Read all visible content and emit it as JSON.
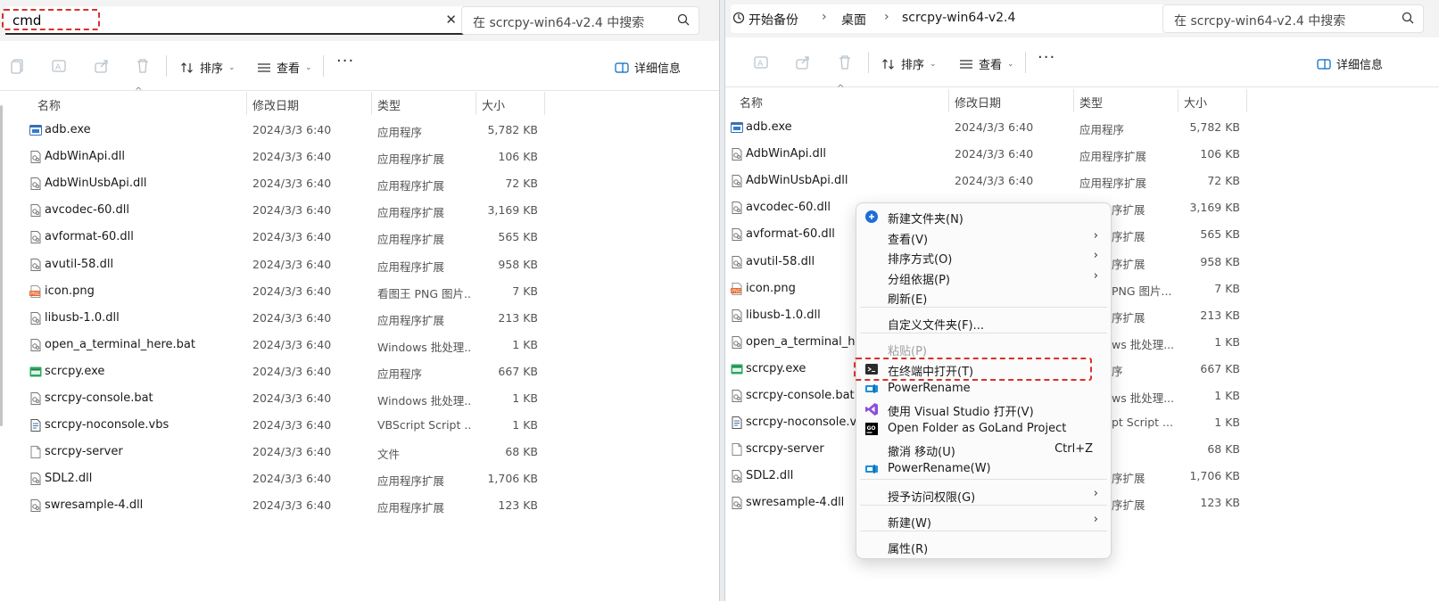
{
  "left": {
    "search_value": "cmd",
    "search_placeholder": "在 scrcpy-win64-v2.4 中搜索",
    "sort_label": "排序",
    "view_label": "查看",
    "details_label": "详细信息"
  },
  "right": {
    "breadcrumbs": [
      "开始备份",
      "桌面",
      "scrcpy-win64-v2.4"
    ],
    "search_placeholder": "在 scrcpy-win64-v2.4 中搜索",
    "sort_label": "排序",
    "view_label": "查看",
    "details_label": "详细信息"
  },
  "columns": {
    "name": "名称",
    "date": "修改日期",
    "type": "类型",
    "size": "大小"
  },
  "files": [
    {
      "name": "adb.exe",
      "date": "2024/3/3 6:40",
      "type": "应用程序",
      "size": "5,782 KB",
      "icon": "exe-icon"
    },
    {
      "name": "AdbWinApi.dll",
      "date": "2024/3/3 6:40",
      "type": "应用程序扩展",
      "size": "106 KB",
      "icon": "dll-icon"
    },
    {
      "name": "AdbWinUsbApi.dll",
      "date": "2024/3/3 6:40",
      "type": "应用程序扩展",
      "size": "72 KB",
      "icon": "dll-icon"
    },
    {
      "name": "avcodec-60.dll",
      "date": "2024/3/3 6:40",
      "type": "应用程序扩展",
      "size": "3,169 KB",
      "icon": "dll-icon"
    },
    {
      "name": "avformat-60.dll",
      "date": "2024/3/3 6:40",
      "type": "应用程序扩展",
      "size": "565 KB",
      "icon": "dll-icon"
    },
    {
      "name": "avutil-58.dll",
      "date": "2024/3/3 6:40",
      "type": "应用程序扩展",
      "size": "958 KB",
      "icon": "dll-icon"
    },
    {
      "name": "icon.png",
      "date": "2024/3/3 6:40",
      "type": "看图王 PNG 图片...",
      "size": "7 KB",
      "icon": "png-icon"
    },
    {
      "name": "libusb-1.0.dll",
      "date": "2024/3/3 6:40",
      "type": "应用程序扩展",
      "size": "213 KB",
      "icon": "dll-icon"
    },
    {
      "name": "open_a_terminal_here.bat",
      "date": "2024/3/3 6:40",
      "type": "Windows 批处理...",
      "size": "1 KB",
      "icon": "bat-icon"
    },
    {
      "name": "scrcpy.exe",
      "date": "2024/3/3 6:40",
      "type": "应用程序",
      "size": "667 KB",
      "icon": "app-icon"
    },
    {
      "name": "scrcpy-console.bat",
      "date": "2024/3/3 6:40",
      "type": "Windows 批处理...",
      "size": "1 KB",
      "icon": "bat-icon"
    },
    {
      "name": "scrcpy-noconsole.vbs",
      "date": "2024/3/3 6:40",
      "type": "VBScript Script ...",
      "size": "1 KB",
      "icon": "vbs-icon"
    },
    {
      "name": "scrcpy-server",
      "date": "2024/3/3 6:40",
      "type": "文件",
      "size": "68 KB",
      "icon": "file-icon"
    },
    {
      "name": "SDL2.dll",
      "date": "2024/3/3 6:40",
      "type": "应用程序扩展",
      "size": "1,706 KB",
      "icon": "dll-icon"
    },
    {
      "name": "swresample-4.dll",
      "date": "2024/3/3 6:40",
      "type": "应用程序扩展",
      "size": "123 KB",
      "icon": "dll-icon"
    }
  ],
  "right_files": [
    {
      "name": "adb.exe",
      "date": "2024/3/3 6:40",
      "type": "应用程序",
      "size": "5,782 KB"
    },
    {
      "name": "AdbWinApi.dll",
      "date": "2024/3/3 6:40",
      "type": "应用程序扩展",
      "size": "106 KB"
    },
    {
      "name": "AdbWinUsbApi.dll",
      "date": "2024/3/3 6:40",
      "type": "应用程序扩展",
      "size": "72 KB"
    },
    {
      "name": "avcodec-60.dll",
      "date": "",
      "type": "序扩展",
      "size": "3,169 KB"
    },
    {
      "name": "avformat-60.dll",
      "date": "",
      "type": "序扩展",
      "size": "565 KB"
    },
    {
      "name": "avutil-58.dll",
      "date": "",
      "type": "序扩展",
      "size": "958 KB"
    },
    {
      "name": "icon.png",
      "date": "",
      "type": "PNG 图片...",
      "size": "7 KB"
    },
    {
      "name": "libusb-1.0.dll",
      "date": "",
      "type": "序扩展",
      "size": "213 KB"
    },
    {
      "name": "open_a_terminal_here",
      "date": "",
      "type": "ws 批处理...",
      "size": "1 KB"
    },
    {
      "name": "scrcpy.exe",
      "date": "",
      "type": "序",
      "size": "667 KB"
    },
    {
      "name": "scrcpy-console.bat",
      "date": "",
      "type": "ws 批处理...",
      "size": "1 KB"
    },
    {
      "name": "scrcpy-noconsole.vbs",
      "date": "",
      "type": "pt Script ...",
      "size": "1 KB"
    },
    {
      "name": "scrcpy-server",
      "date": "",
      "type": "",
      "size": "68 KB"
    },
    {
      "name": "SDL2.dll",
      "date": "",
      "type": "序扩展",
      "size": "1,706 KB"
    },
    {
      "name": "swresample-4.dll",
      "date": "",
      "type": "序扩展",
      "size": "123 KB"
    }
  ],
  "context_menu": [
    {
      "label": "新建文件夹(N)",
      "icon": "new-folder-icon",
      "arrow": false,
      "key": ""
    },
    {
      "label": "查看(V)",
      "icon": "",
      "arrow": true,
      "key": ""
    },
    {
      "label": "排序方式(O)",
      "icon": "",
      "arrow": true,
      "key": ""
    },
    {
      "label": "分组依据(P)",
      "icon": "",
      "arrow": true,
      "key": ""
    },
    {
      "label": "刷新(E)",
      "icon": "",
      "arrow": false,
      "key": ""
    },
    {
      "label": "自定义文件夹(F)...",
      "icon": "",
      "arrow": false,
      "key": ""
    },
    {
      "label": "粘贴(P)",
      "icon": "",
      "arrow": false,
      "key": "",
      "disabled": true
    },
    {
      "label": "在终端中打开(T)",
      "icon": "terminal-icon",
      "arrow": false,
      "key": ""
    },
    {
      "label": "PowerRename",
      "icon": "powerrename-icon",
      "arrow": false,
      "key": ""
    },
    {
      "label": "使用 Visual Studio 打开(V)",
      "icon": "visual-studio-icon",
      "arrow": false,
      "key": ""
    },
    {
      "label": "Open Folder as GoLand Project",
      "icon": "goland-icon",
      "arrow": false,
      "key": ""
    },
    {
      "label": "撤消 移动(U)",
      "icon": "",
      "arrow": false,
      "key": "Ctrl+Z"
    },
    {
      "label": "PowerRename(W)",
      "icon": "powerrename-icon",
      "arrow": false,
      "key": ""
    },
    {
      "label": "授予访问权限(G)",
      "icon": "",
      "arrow": true,
      "key": ""
    },
    {
      "label": "新建(W)",
      "icon": "",
      "arrow": true,
      "key": ""
    },
    {
      "label": "属性(R)",
      "icon": "",
      "arrow": false,
      "key": ""
    }
  ],
  "colors": {
    "highlight": "#d9312b",
    "accent": "#0067c0"
  }
}
